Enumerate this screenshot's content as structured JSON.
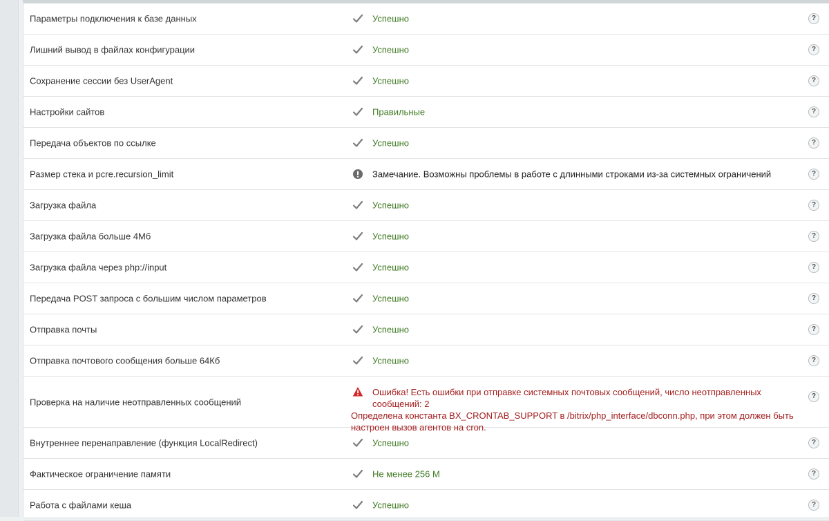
{
  "colors": {
    "ok": "#3f7a23",
    "error": "#a31c1c",
    "warn_icon": "#6b6b6b"
  },
  "help_label": "?",
  "rows": [
    {
      "name": "Параметры подключения к базе данных",
      "status": "ok",
      "icon": "check-icon",
      "text": "Успешно"
    },
    {
      "name": "Лишний вывод в файлах конфигурации",
      "status": "ok",
      "icon": "check-icon",
      "text": "Успешно"
    },
    {
      "name": "Сохранение сессии без UserAgent",
      "status": "ok",
      "icon": "check-icon",
      "text": "Успешно"
    },
    {
      "name": "Настройки сайтов",
      "status": "ok",
      "icon": "check-icon",
      "text": "Правильные"
    },
    {
      "name": "Передача объектов по ссылке",
      "status": "ok",
      "icon": "check-icon",
      "text": "Успешно"
    },
    {
      "name": "Размер стека и pcre.recursion_limit",
      "status": "warn",
      "icon": "warning-circle-icon",
      "text": "Замечание. Возможны проблемы в работе с длинными строками из-за системных ограничений"
    },
    {
      "name": "Загрузка файла",
      "status": "ok",
      "icon": "check-icon",
      "text": "Успешно"
    },
    {
      "name": "Загрузка файла больше 4Мб",
      "status": "ok",
      "icon": "check-icon",
      "text": "Успешно"
    },
    {
      "name": "Загрузка файла через php://input",
      "status": "ok",
      "icon": "check-icon",
      "text": "Успешно"
    },
    {
      "name": "Передача POST запроса с большим числом параметров",
      "status": "ok",
      "icon": "check-icon",
      "text": "Успешно"
    },
    {
      "name": "Отправка почты",
      "status": "ok",
      "icon": "check-icon",
      "text": "Успешно"
    },
    {
      "name": "Отправка почтового сообщения больше 64Кб",
      "status": "ok",
      "icon": "check-icon",
      "text": "Успешно"
    },
    {
      "name": "Проверка на наличие неотправленных сообщений",
      "status": "error",
      "icon": "error-triangle-icon",
      "text": "Ошибка! Есть ошибки при отправке системных почтовых сообщений, число неотправленных сообщений: 2",
      "text2": "Определена константа BX_CRONTAB_SUPPORT в /bitrix/php_interface/dbconn.php, при этом должен быть настроен вызов агентов на cron."
    },
    {
      "name": "Внутреннее перенаправление (функция LocalRedirect)",
      "status": "ok",
      "icon": "check-icon",
      "text": "Успешно"
    },
    {
      "name": "Фактическое ограничение памяти",
      "status": "ok",
      "icon": "check-icon",
      "text": "Не менее 256 М"
    },
    {
      "name": "Работа с файлами кеша",
      "status": "ok",
      "icon": "check-icon",
      "text": "Успешно"
    }
  ]
}
